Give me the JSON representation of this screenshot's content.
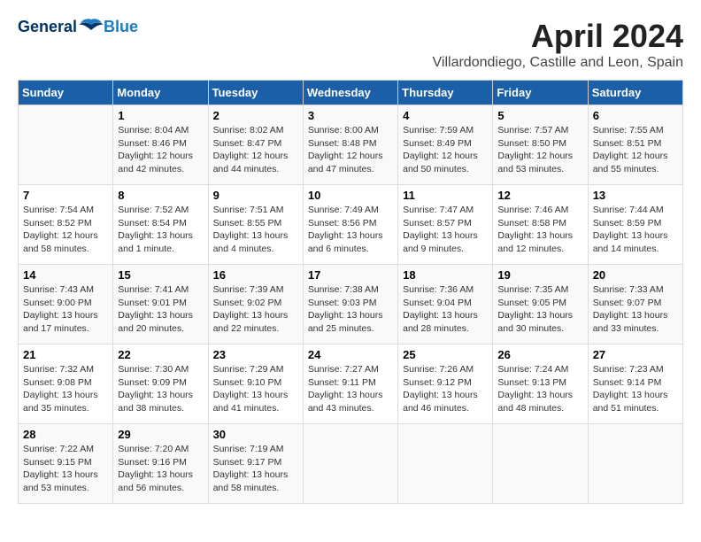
{
  "header": {
    "logo_line1": "General",
    "logo_line2": "Blue",
    "month": "April 2024",
    "location": "Villardondiego, Castille and Leon, Spain"
  },
  "weekdays": [
    "Sunday",
    "Monday",
    "Tuesday",
    "Wednesday",
    "Thursday",
    "Friday",
    "Saturday"
  ],
  "weeks": [
    [
      {
        "day": "",
        "sunrise": "",
        "sunset": "",
        "daylight": ""
      },
      {
        "day": "1",
        "sunrise": "Sunrise: 8:04 AM",
        "sunset": "Sunset: 8:46 PM",
        "daylight": "Daylight: 12 hours and 42 minutes."
      },
      {
        "day": "2",
        "sunrise": "Sunrise: 8:02 AM",
        "sunset": "Sunset: 8:47 PM",
        "daylight": "Daylight: 12 hours and 44 minutes."
      },
      {
        "day": "3",
        "sunrise": "Sunrise: 8:00 AM",
        "sunset": "Sunset: 8:48 PM",
        "daylight": "Daylight: 12 hours and 47 minutes."
      },
      {
        "day": "4",
        "sunrise": "Sunrise: 7:59 AM",
        "sunset": "Sunset: 8:49 PM",
        "daylight": "Daylight: 12 hours and 50 minutes."
      },
      {
        "day": "5",
        "sunrise": "Sunrise: 7:57 AM",
        "sunset": "Sunset: 8:50 PM",
        "daylight": "Daylight: 12 hours and 53 minutes."
      },
      {
        "day": "6",
        "sunrise": "Sunrise: 7:55 AM",
        "sunset": "Sunset: 8:51 PM",
        "daylight": "Daylight: 12 hours and 55 minutes."
      }
    ],
    [
      {
        "day": "7",
        "sunrise": "Sunrise: 7:54 AM",
        "sunset": "Sunset: 8:52 PM",
        "daylight": "Daylight: 12 hours and 58 minutes."
      },
      {
        "day": "8",
        "sunrise": "Sunrise: 7:52 AM",
        "sunset": "Sunset: 8:54 PM",
        "daylight": "Daylight: 13 hours and 1 minute."
      },
      {
        "day": "9",
        "sunrise": "Sunrise: 7:51 AM",
        "sunset": "Sunset: 8:55 PM",
        "daylight": "Daylight: 13 hours and 4 minutes."
      },
      {
        "day": "10",
        "sunrise": "Sunrise: 7:49 AM",
        "sunset": "Sunset: 8:56 PM",
        "daylight": "Daylight: 13 hours and 6 minutes."
      },
      {
        "day": "11",
        "sunrise": "Sunrise: 7:47 AM",
        "sunset": "Sunset: 8:57 PM",
        "daylight": "Daylight: 13 hours and 9 minutes."
      },
      {
        "day": "12",
        "sunrise": "Sunrise: 7:46 AM",
        "sunset": "Sunset: 8:58 PM",
        "daylight": "Daylight: 13 hours and 12 minutes."
      },
      {
        "day": "13",
        "sunrise": "Sunrise: 7:44 AM",
        "sunset": "Sunset: 8:59 PM",
        "daylight": "Daylight: 13 hours and 14 minutes."
      }
    ],
    [
      {
        "day": "14",
        "sunrise": "Sunrise: 7:43 AM",
        "sunset": "Sunset: 9:00 PM",
        "daylight": "Daylight: 13 hours and 17 minutes."
      },
      {
        "day": "15",
        "sunrise": "Sunrise: 7:41 AM",
        "sunset": "Sunset: 9:01 PM",
        "daylight": "Daylight: 13 hours and 20 minutes."
      },
      {
        "day": "16",
        "sunrise": "Sunrise: 7:39 AM",
        "sunset": "Sunset: 9:02 PM",
        "daylight": "Daylight: 13 hours and 22 minutes."
      },
      {
        "day": "17",
        "sunrise": "Sunrise: 7:38 AM",
        "sunset": "Sunset: 9:03 PM",
        "daylight": "Daylight: 13 hours and 25 minutes."
      },
      {
        "day": "18",
        "sunrise": "Sunrise: 7:36 AM",
        "sunset": "Sunset: 9:04 PM",
        "daylight": "Daylight: 13 hours and 28 minutes."
      },
      {
        "day": "19",
        "sunrise": "Sunrise: 7:35 AM",
        "sunset": "Sunset: 9:05 PM",
        "daylight": "Daylight: 13 hours and 30 minutes."
      },
      {
        "day": "20",
        "sunrise": "Sunrise: 7:33 AM",
        "sunset": "Sunset: 9:07 PM",
        "daylight": "Daylight: 13 hours and 33 minutes."
      }
    ],
    [
      {
        "day": "21",
        "sunrise": "Sunrise: 7:32 AM",
        "sunset": "Sunset: 9:08 PM",
        "daylight": "Daylight: 13 hours and 35 minutes."
      },
      {
        "day": "22",
        "sunrise": "Sunrise: 7:30 AM",
        "sunset": "Sunset: 9:09 PM",
        "daylight": "Daylight: 13 hours and 38 minutes."
      },
      {
        "day": "23",
        "sunrise": "Sunrise: 7:29 AM",
        "sunset": "Sunset: 9:10 PM",
        "daylight": "Daylight: 13 hours and 41 minutes."
      },
      {
        "day": "24",
        "sunrise": "Sunrise: 7:27 AM",
        "sunset": "Sunset: 9:11 PM",
        "daylight": "Daylight: 13 hours and 43 minutes."
      },
      {
        "day": "25",
        "sunrise": "Sunrise: 7:26 AM",
        "sunset": "Sunset: 9:12 PM",
        "daylight": "Daylight: 13 hours and 46 minutes."
      },
      {
        "day": "26",
        "sunrise": "Sunrise: 7:24 AM",
        "sunset": "Sunset: 9:13 PM",
        "daylight": "Daylight: 13 hours and 48 minutes."
      },
      {
        "day": "27",
        "sunrise": "Sunrise: 7:23 AM",
        "sunset": "Sunset: 9:14 PM",
        "daylight": "Daylight: 13 hours and 51 minutes."
      }
    ],
    [
      {
        "day": "28",
        "sunrise": "Sunrise: 7:22 AM",
        "sunset": "Sunset: 9:15 PM",
        "daylight": "Daylight: 13 hours and 53 minutes."
      },
      {
        "day": "29",
        "sunrise": "Sunrise: 7:20 AM",
        "sunset": "Sunset: 9:16 PM",
        "daylight": "Daylight: 13 hours and 56 minutes."
      },
      {
        "day": "30",
        "sunrise": "Sunrise: 7:19 AM",
        "sunset": "Sunset: 9:17 PM",
        "daylight": "Daylight: 13 hours and 58 minutes."
      },
      {
        "day": "",
        "sunrise": "",
        "sunset": "",
        "daylight": ""
      },
      {
        "day": "",
        "sunrise": "",
        "sunset": "",
        "daylight": ""
      },
      {
        "day": "",
        "sunrise": "",
        "sunset": "",
        "daylight": ""
      },
      {
        "day": "",
        "sunrise": "",
        "sunset": "",
        "daylight": ""
      }
    ]
  ]
}
